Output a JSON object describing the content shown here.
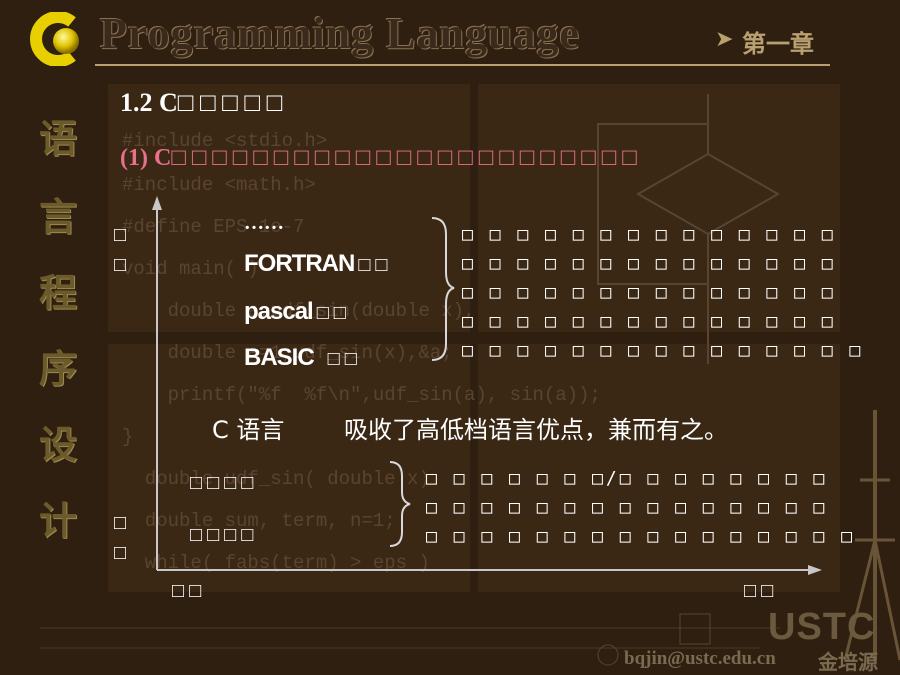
{
  "header": {
    "logo_letter": "C",
    "title": "Programming Language",
    "chapter": "第一章"
  },
  "side_title": [
    "语",
    "言",
    "程",
    "序",
    "设",
    "计"
  ],
  "slide": {
    "section_heading": "1.2 C□ □ □ □ □",
    "subheading": "(1) C□ □ □ □ □ □ □ □ □ □ □ □ □ □ □ □ □ □ □ □ □ □ □",
    "y_axis_label": [
      "□",
      "□"
    ],
    "y_axis_label_lower": [
      "□",
      "□"
    ],
    "x_axis_label_left": "□ □",
    "x_axis_label_right": "□ □",
    "high_level": {
      "ellipsis": "……",
      "languages": [
        {
          "name": "FORTRAN",
          "suffix": "□ □"
        },
        {
          "name": "pascal",
          "suffix": "□ □"
        },
        {
          "name": "BASIC",
          "suffix": "□ □"
        }
      ],
      "description": [
        "□ □ □ □ □ □ □ □ □ □ □ □ □ □",
        "□ □ □ □ □ □ □ □ □ □ □ □ □ □",
        "□ □ □ □ □ □ □ □ □ □ □ □ □ □",
        "□ □ □ □ □ □ □ □ □ □ □ □ □ □",
        "□ □ □ □ □ □ □ □ □ □ □ □ □ □ □"
      ]
    },
    "c_language": {
      "name": "C 语言",
      "summary": "吸收了高低档语言优点，兼而有之。"
    },
    "low_level": {
      "items": [
        "□ □ □ □",
        "□ □ □ □"
      ],
      "description": [
        "□ □ □ □ □ □ □/□ □ □ □ □ □ □ □",
        "□ □ □ □ □ □ □ □ □ □ □ □ □ □ □",
        "□ □ □ □ □ □ □ □ □ □ □ □ □ □ □ □"
      ]
    }
  },
  "background_code": [
    "#include <stdio.h>",
    "#include <math.h>",
    "#define EPS 1e-7",
    "void main( )",
    "    double a,udf_sin(double x),",
    "    double a=1,udf_sin(x),&a;",
    "    printf(\"%f  %f\\n\",udf_sin(a), sin(a));",
    "}",
    "  double udf_sin( double x)",
    "  double sum, term, n=1;",
    "  while( fabs(term) > eps )"
  ],
  "footer": {
    "watermark": "USTC",
    "email": "bqjin@ustc.edu.cn",
    "author": "金培源"
  }
}
